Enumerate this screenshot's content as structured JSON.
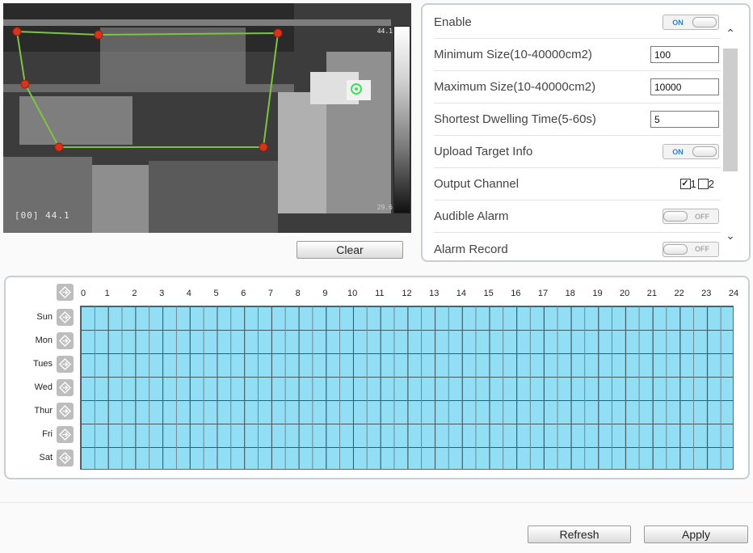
{
  "video": {
    "osd_temperature": "[00] 44.1",
    "scale_max": "44.1",
    "scale_min": "29.6"
  },
  "clear_label": "Clear",
  "settings": {
    "enable": {
      "label": "Enable",
      "state": "ON"
    },
    "min_size": {
      "label": "Minimum Size(10-40000cm2)",
      "value": "100"
    },
    "max_size": {
      "label": "Maximum Size(10-40000cm2)",
      "value": "10000"
    },
    "dwell_time": {
      "label": "Shortest Dwelling Time(5-60s)",
      "value": "5"
    },
    "upload_target": {
      "label": "Upload Target Info",
      "state": "ON"
    },
    "output_channel": {
      "label": "Output Channel",
      "channels": [
        "1",
        "2"
      ],
      "checked": [
        true,
        false
      ]
    },
    "audible_alarm": {
      "label": "Audible Alarm",
      "state": "OFF"
    },
    "alarm_record": {
      "label": "Alarm Record",
      "state": "OFF"
    }
  },
  "schedule": {
    "hours": [
      "0",
      "1",
      "2",
      "3",
      "4",
      "5",
      "6",
      "7",
      "8",
      "9",
      "10",
      "11",
      "12",
      "13",
      "14",
      "15",
      "16",
      "17",
      "18",
      "19",
      "20",
      "21",
      "22",
      "23",
      "24"
    ],
    "days": [
      "Sun",
      "Mon",
      "Tues",
      "Wed",
      "Thur",
      "Fri",
      "Sat"
    ],
    "cell_color": "#92dff5",
    "all_armed": true
  },
  "footer": {
    "refresh_label": "Refresh",
    "apply_label": "Apply"
  },
  "colors": {
    "zone_line": "#7cc442",
    "zone_vertex": "#d9331c",
    "toggle_on_text": "#2f7fd0"
  }
}
